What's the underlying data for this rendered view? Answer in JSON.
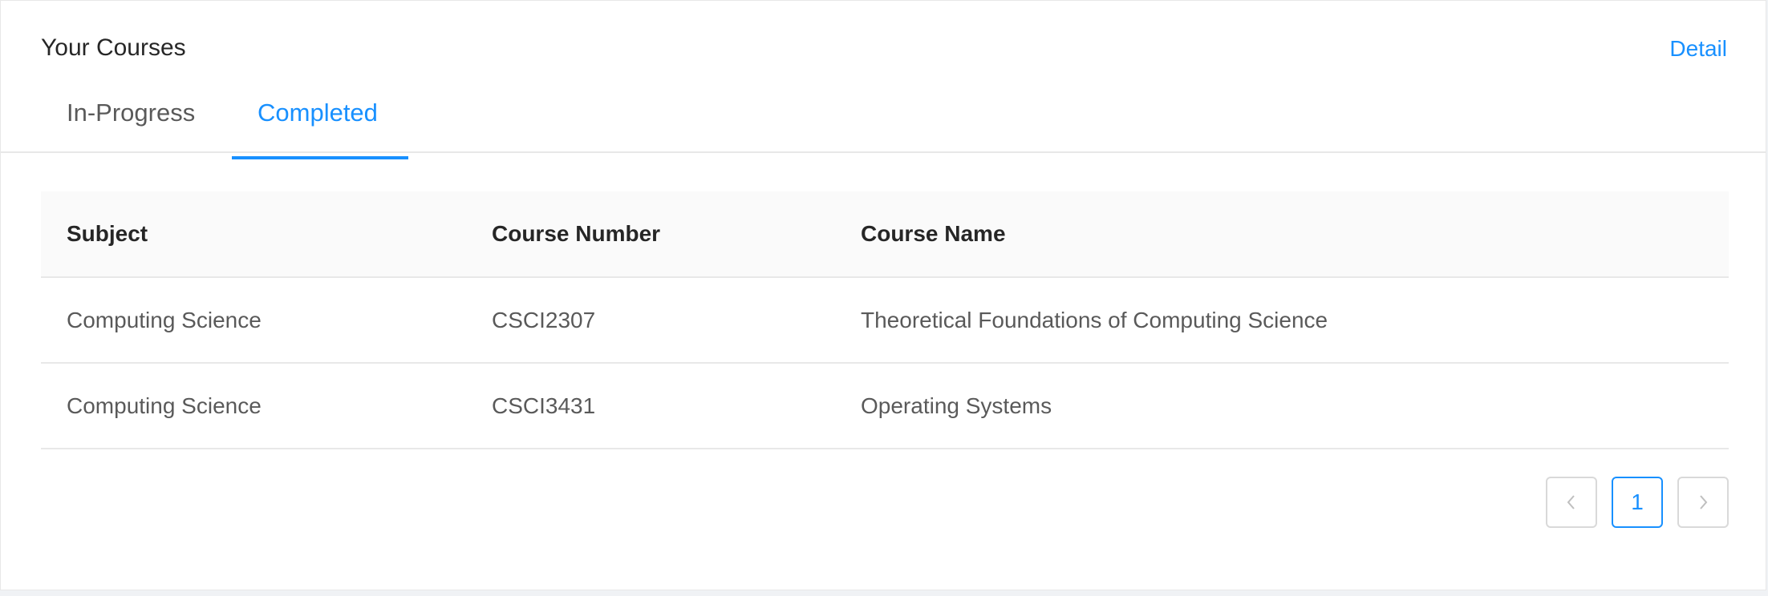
{
  "card": {
    "title": "Your Courses",
    "extra_link": "Detail"
  },
  "tabs": [
    {
      "label": "In-Progress",
      "active": false
    },
    {
      "label": "Completed",
      "active": true
    }
  ],
  "table": {
    "columns": [
      "Subject",
      "Course Number",
      "Course Name"
    ],
    "rows": [
      [
        "Computing Science",
        "CSCI2307",
        "Theoretical Foundations of Computing Science"
      ],
      [
        "Computing Science",
        "CSCI3431",
        "Operating Systems"
      ]
    ]
  },
  "pagination": {
    "current_page": "1",
    "prev_icon": "chevron-left-icon",
    "next_icon": "chevron-right-icon"
  },
  "colors": {
    "accent": "#1890ff",
    "border": "#e8e8e8",
    "header_bg": "#fafafa"
  }
}
